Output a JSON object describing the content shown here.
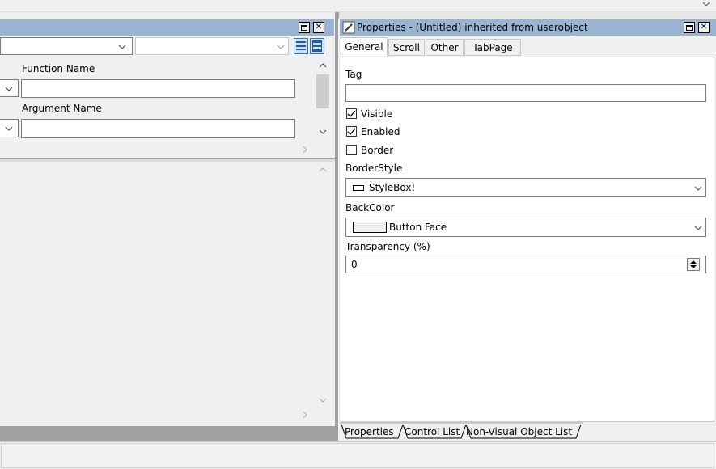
{
  "left_panel": {
    "labels": {
      "function_name": "Function Name",
      "argument_name": "Argument Name"
    },
    "function_value": "",
    "argument_value": ""
  },
  "properties": {
    "title": "Properties - (Untitled)  inherited  from  userobject",
    "tabs": [
      "General",
      "Scroll",
      "Other",
      "TabPage"
    ],
    "active_tab": "General",
    "tag_label": "Tag",
    "tag_value": "",
    "checkboxes": [
      {
        "label": "Visible",
        "checked": true
      },
      {
        "label": "Enabled",
        "checked": true
      },
      {
        "label": "Border",
        "checked": false
      }
    ],
    "borderstyle_label": "BorderStyle",
    "borderstyle_value": "StyleBox!",
    "backcolor_label": "BackColor",
    "backcolor_value": "Button Face",
    "transparency_label": "Transparency (%)",
    "transparency_value": "0"
  },
  "bottom_tabs": [
    "Properties",
    "Control List",
    "Non-Visual Object List"
  ],
  "colors": {
    "titlebar": "#99b4d1",
    "window_bg": "#f0f0f0",
    "field_border": "#7a7a7a"
  }
}
